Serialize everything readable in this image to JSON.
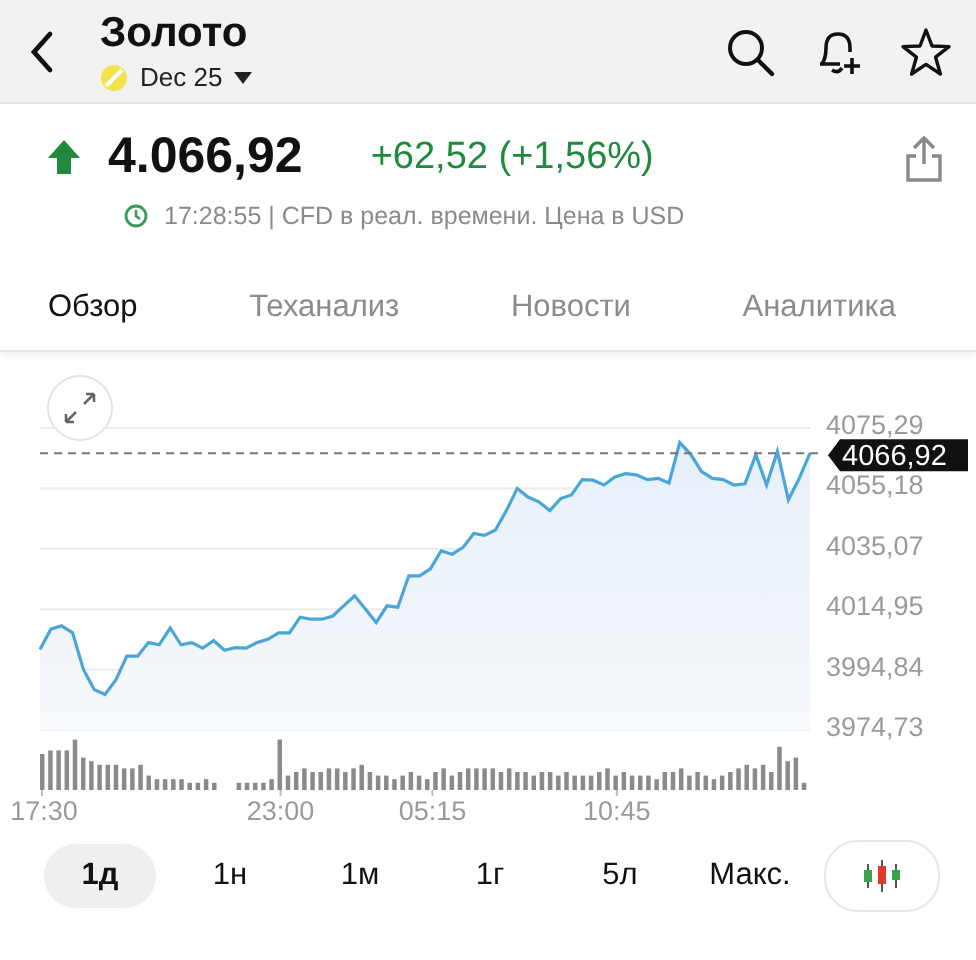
{
  "header": {
    "title": "Золото",
    "contract": "Dec 25"
  },
  "quote": {
    "price": "4.066,92",
    "change": "+62,52 (+1,56%)",
    "rising": true,
    "timestamp": "17:28:55 | CFD в реал. времени. Цена в USD"
  },
  "tabs": [
    {
      "label": "Обзор",
      "selected": true
    },
    {
      "label": "Теханализ",
      "selected": false
    },
    {
      "label": "Новости",
      "selected": false
    },
    {
      "label": "Аналитика",
      "selected": false
    }
  ],
  "chart": {
    "chart_data": {
      "type": "area",
      "grid": true,
      "ref_lines": [
        {
          "axis": "y",
          "value": 4066.92,
          "label": "4066,92"
        }
      ],
      "categories": [
        "17:30",
        null,
        null,
        null,
        null,
        null,
        null,
        null,
        null,
        null,
        null,
        null,
        null,
        null,
        null,
        null,
        null,
        null,
        null,
        null,
        null,
        null,
        "23:00",
        null,
        null,
        null,
        null,
        null,
        null,
        null,
        null,
        null,
        null,
        null,
        null,
        null,
        "05:15",
        null,
        null,
        null,
        null,
        null,
        null,
        null,
        null,
        null,
        null,
        null,
        null,
        null,
        null,
        null,
        null,
        "10:45",
        null,
        null,
        null,
        null,
        null,
        null,
        null,
        null,
        null,
        null,
        null,
        null,
        null,
        null,
        null,
        null,
        null,
        null
      ],
      "series": [
        {
          "color": "#4aa6d6",
          "values": [
            4001.6,
            4008.3,
            4009.4,
            4007.1,
            3994.9,
            3988.2,
            3986.6,
            3991.5,
            3999.3,
            3999.3,
            4003.8,
            4003.1,
            4008.7,
            4003.1,
            4003.8,
            4002.0,
            4004.5,
            4001.3,
            4002.2,
            4002.0,
            4003.8,
            4004.9,
            4007.1,
            4007.1,
            4012.3,
            4011.6,
            4011.6,
            4012.7,
            4016.1,
            4019.4,
            4015.0,
            4010.5,
            4016.1,
            4015.6,
            4026.1,
            4026.1,
            4028.4,
            4034.4,
            4033.3,
            4035.5,
            4040.2,
            4039.5,
            4041.3,
            4047.8,
            4055.2,
            4052.3,
            4050.7,
            4047.8,
            4051.8,
            4053.0,
            4058.1,
            4057.9,
            4056.3,
            4059.0,
            4060.1,
            4059.7,
            4058.1,
            4058.5,
            4057.0,
            4070.4,
            4066.4,
            4060.8,
            4058.5,
            4058.1,
            4056.3,
            4056.7,
            4066.4,
            4056.3,
            4067.5,
            4051.4,
            4058.5,
            4066.9
          ]
        }
      ],
      "ylim": [
        3974.73,
        4075.29
      ],
      "yticks": [
        {
          "value": 4075.29,
          "label": "4075,29"
        },
        {
          "value": 4055.18,
          "label": "4055,18"
        },
        {
          "value": 4035.07,
          "label": "4035,07"
        },
        {
          "value": 4014.95,
          "label": "4014,95"
        },
        {
          "value": 3994.84,
          "label": "3994,84"
        },
        {
          "value": 3974.73,
          "label": "3974,73"
        }
      ]
    }
  },
  "ranges": [
    {
      "label": "1д",
      "selected": true
    },
    {
      "label": "1н",
      "selected": false
    },
    {
      "label": "1м",
      "selected": false
    },
    {
      "label": "1г",
      "selected": false
    },
    {
      "label": "5л",
      "selected": false
    },
    {
      "label": "Макс.",
      "selected": false
    }
  ]
}
